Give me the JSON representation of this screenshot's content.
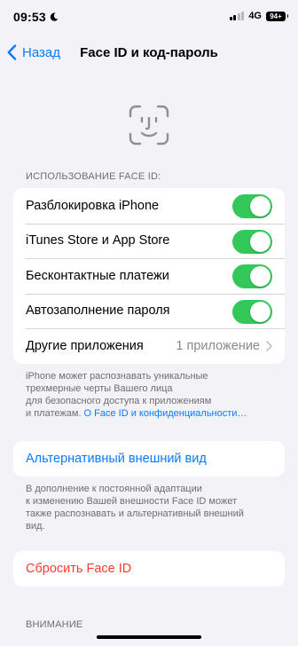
{
  "status_bar": {
    "time": "09:53",
    "network": "4G",
    "battery": "94+",
    "moon_icon": "moon-icon"
  },
  "nav": {
    "back_label": "Назад",
    "title": "Face ID и код-пароль"
  },
  "faceid_section": {
    "header": "ИСПОЛЬЗОВАНИЕ FACE ID:",
    "rows": [
      {
        "label": "Разблокировка iPhone",
        "on": true
      },
      {
        "label": "iTunes Store и App Store",
        "on": true
      },
      {
        "label": "Бесконтактные платежи",
        "on": true
      },
      {
        "label": "Автозаполнение пароля",
        "on": true
      }
    ],
    "other_apps": {
      "label": "Другие приложения",
      "value": "1 приложение"
    },
    "footer_lines": [
      "iPhone может распознавать уникальные",
      "трехмерные черты Вашего лица",
      "для безопасного доступа к приложениям",
      "и платежам."
    ],
    "footer_link": "О Face ID и конфиденциальности…"
  },
  "alt_appearance": {
    "label": "Альтернативный внешний вид",
    "footer_lines": [
      "В дополнение к постоянной адаптации",
      "к изменению Вашей внешности Face ID может",
      "также распознавать и альтернативный внешний",
      "вид."
    ]
  },
  "reset": {
    "label": "Сбросить Face ID"
  },
  "attention": {
    "header": "ВНИМАНИЕ"
  },
  "colors": {
    "accent": "#0a7aff",
    "toggle_on": "#34c759",
    "destructive": "#ff3b30",
    "background": "#f2f2f7"
  }
}
